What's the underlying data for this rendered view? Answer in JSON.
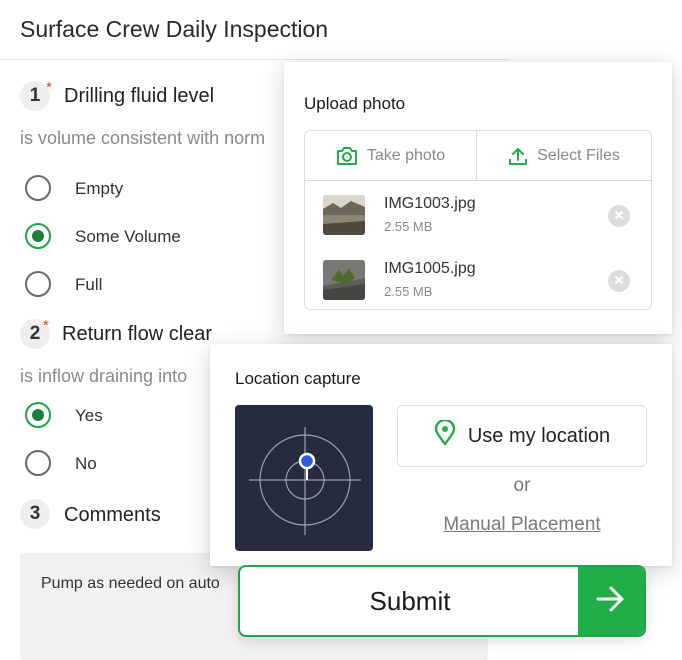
{
  "form": {
    "title": "Surface Crew Daily Inspection",
    "questions": [
      {
        "number": "1",
        "required_mark": "*",
        "text": "Drilling fluid level",
        "subtitle": "is volume consistent with norm",
        "options": [
          {
            "label": "Empty",
            "selected": false
          },
          {
            "label": "Some Volume",
            "selected": true
          },
          {
            "label": "Full",
            "selected": false
          }
        ]
      },
      {
        "number": "2",
        "required_mark": "*",
        "text": "Return flow clear",
        "subtitle": "is inflow draining into",
        "options": [
          {
            "label": "Yes",
            "selected": true
          },
          {
            "label": "No",
            "selected": false
          }
        ]
      },
      {
        "number": "3",
        "text": "Comments",
        "value": "Pump as needed on auto"
      }
    ]
  },
  "upload": {
    "title": "Upload photo",
    "take_photo_label": "Take photo",
    "select_files_label": "Select Files",
    "files": [
      {
        "name": "IMG1003.jpg",
        "size": "2.55 MB"
      },
      {
        "name": "IMG1005.jpg",
        "size": "2.55 MB"
      }
    ]
  },
  "location": {
    "title": "Location capture",
    "use_location_label": "Use my location",
    "or_label": "or",
    "manual_label": "Manual Placement"
  },
  "submit": {
    "label": "Submit"
  },
  "colors": {
    "accent_green": "#1fae47",
    "radio_selected": "#1b7f3b",
    "required_red": "#e53935",
    "map_background": "#272b3f",
    "location_dot": "#2f5bd8"
  },
  "icons": {
    "take_photo": "camera-icon",
    "select_files": "upload-icon",
    "remove_file": "close-icon",
    "use_location": "map-pin-icon",
    "submit": "arrow-right-icon"
  }
}
